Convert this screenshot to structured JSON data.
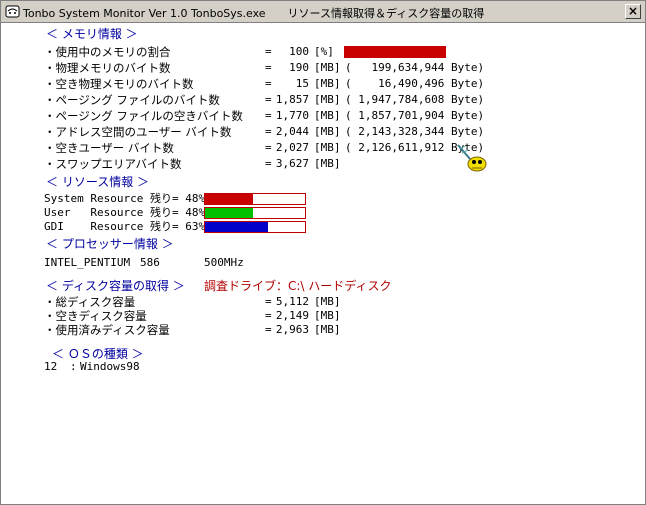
{
  "window": {
    "title": "Tonbo System Monitor Ver 1.0 TonboSys.exe　　リソース情報取得＆ディスク容量の取得",
    "close_label": "×"
  },
  "memory": {
    "header": "＜ メモリ情報 ＞",
    "percent": 100,
    "rows": [
      {
        "label": "・使用中のメモリの割合",
        "eq": "=",
        "value": "100",
        "unit": "[%]",
        "bytes": ""
      },
      {
        "label": "・物理メモリのバイト数",
        "eq": "=",
        "value": "190",
        "unit": "[MB]",
        "bytes": "(   199,634,944 Byte)"
      },
      {
        "label": "・空き物理メモリのバイト数",
        "eq": "=",
        "value": "15",
        "unit": "[MB]",
        "bytes": "(    16,490,496 Byte)"
      },
      {
        "label": "・ページング ファイルのバイト数",
        "eq": "=",
        "value": "1,857",
        "unit": "[MB]",
        "bytes": "( 1,947,784,608 Byte)"
      },
      {
        "label": "・ページング ファイルの空きバイト数",
        "eq": "=",
        "value": "1,770",
        "unit": "[MB]",
        "bytes": "( 1,857,701,904 Byte)"
      },
      {
        "label": "・アドレス空間のユーザー バイト数",
        "eq": "=",
        "value": "2,044",
        "unit": "[MB]",
        "bytes": "( 2,143,328,344 Byte)"
      },
      {
        "label": "・空きユーザー バイト数",
        "eq": "=",
        "value": "2,027",
        "unit": "[MB]",
        "bytes": "( 2,126,611,912 Byte)"
      },
      {
        "label": "・スワップエリアバイト数",
        "eq": "=",
        "value": "3,627",
        "unit": "[MB]",
        "bytes": ""
      }
    ]
  },
  "resources": {
    "header": "＜ リソース情報 ＞",
    "rows": [
      {
        "label": "System Resource 残り= 48%",
        "percent": 48,
        "color": "#c80000"
      },
      {
        "label": "User   Resource 残り= 48%",
        "percent": 48,
        "color": "#00c000"
      },
      {
        "label": "GDI    Resource 残り= 63%",
        "percent": 63,
        "color": "#0000c8"
      }
    ]
  },
  "processor": {
    "header": "＜ プロセッサー情報 ＞",
    "name": "INTEL_PENTIUM",
    "model": "586",
    "speed": "500MHz"
  },
  "disk": {
    "header": "＜ ディスク容量の取得 ＞",
    "drive_label": "調査ドライブ：C:\\ ハードディスク",
    "rows": [
      {
        "label": "・総ディスク容量",
        "eq": "=",
        "value": "5,112",
        "unit": "[MB]"
      },
      {
        "label": "・空きディスク容量",
        "eq": "=",
        "value": "2,149",
        "unit": "[MB]"
      },
      {
        "label": "・使用済みディスク容量",
        "eq": "=",
        "value": "2,963",
        "unit": "[MB]"
      }
    ]
  },
  "os": {
    "header": "＜ ＯＳの種類 ＞",
    "code": "12",
    "sep": ":",
    "name": "Windows98"
  },
  "colors": {
    "header": "#0000a0",
    "drive": "#b00000",
    "memory_bar": "#c80000"
  }
}
